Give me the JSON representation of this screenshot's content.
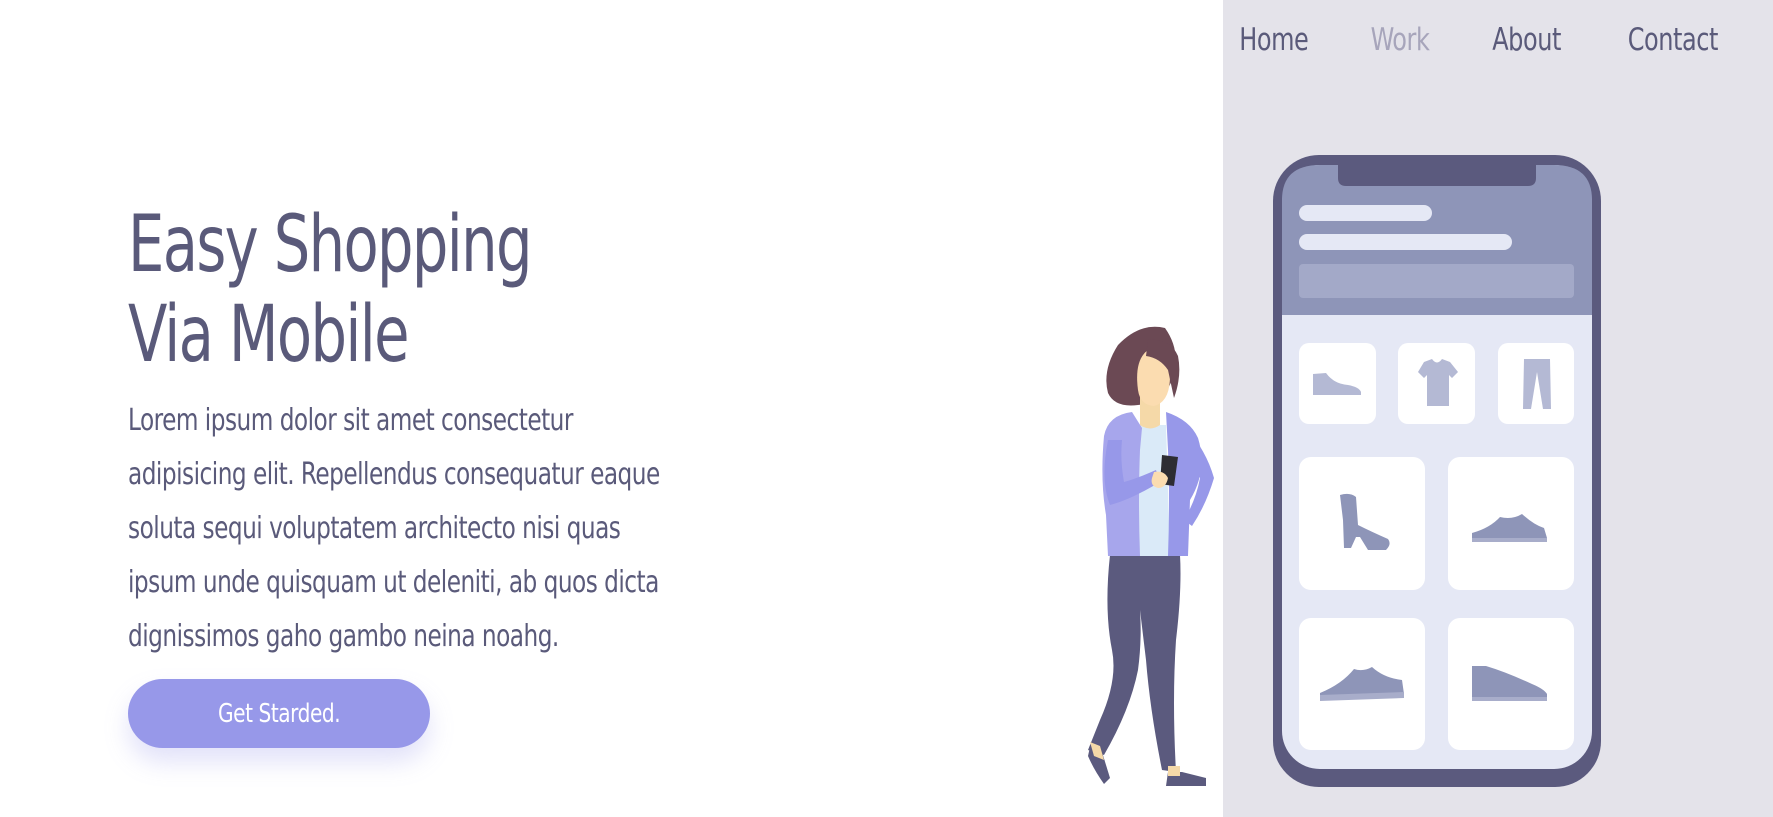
{
  "nav": {
    "items": [
      {
        "label": "Home",
        "active": false
      },
      {
        "label": "Work",
        "active": true
      },
      {
        "label": "About",
        "active": false
      },
      {
        "label": "Contact",
        "active": false
      }
    ]
  },
  "hero": {
    "title_line1": "Easy Shopping",
    "title_line2": "Via Mobile",
    "description": "Lorem ipsum dolor sit amet consectetur adipisicing elit. Repellendus consequatur eaque soluta sequi voluptatem architecto nisi quas ipsum unde quisquam ut deleniti, ab quos dicta dignissimos gaho gambo neina noahg.",
    "cta_label": "Get Starded."
  },
  "colors": {
    "text": "#5a5a7a",
    "nav_active": "#a7a5bb",
    "accent": "#9798e9",
    "panel_bg": "#e4e3ea",
    "phone_frame": "#5b5a7e",
    "phone_header": "#8e95b8",
    "phone_screen": "#e5e8f5"
  },
  "illustration": {
    "phone_products": [
      "shoe-icon",
      "tshirt-icon",
      "pants-icon",
      "boot-icon",
      "sneaker-icon",
      "sneaker-icon",
      "sneaker-icon"
    ],
    "person": "woman-holding-phone"
  }
}
